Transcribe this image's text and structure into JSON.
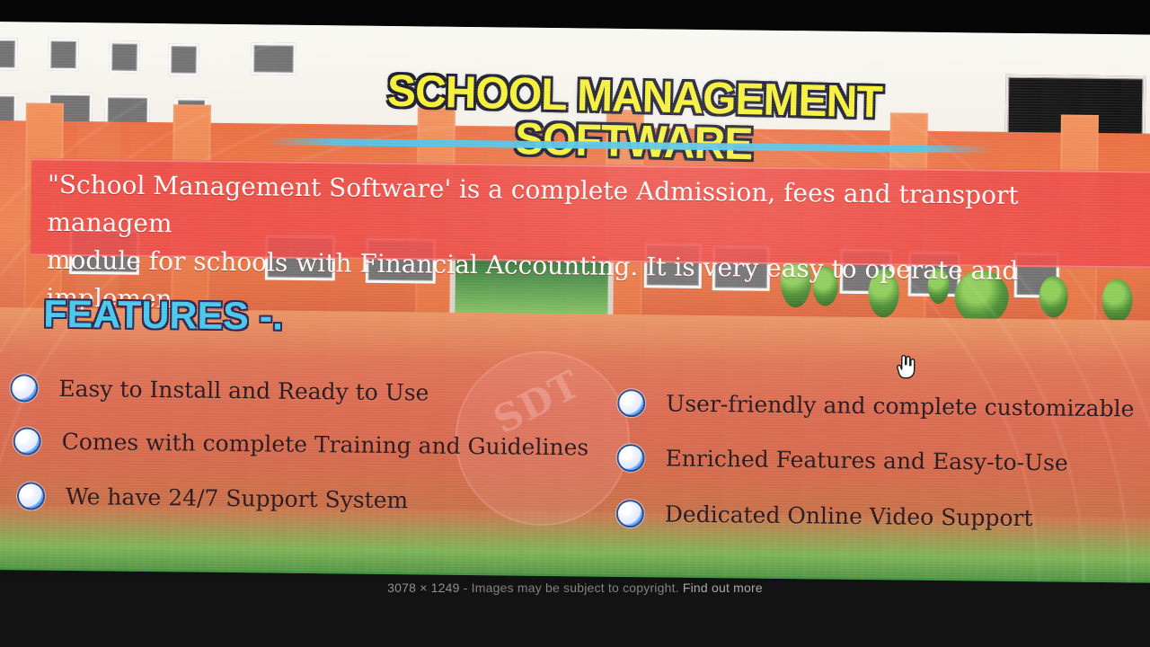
{
  "banner": {
    "title": "SCHOOL MANAGEMENT SOFTWARE",
    "intro_line_1": "\"School Management Software' is a complete Admission, fees and transport managem",
    "intro_line_2": "module for schools with Financial Accounting. It is very easy to operate and implemen",
    "features_heading": "FEATURES -.",
    "watermark": "SDT"
  },
  "features": {
    "left": [
      "Easy to Install and Ready to Use",
      "Comes with complete Training and Guidelines",
      "We have 24/7 Support System"
    ],
    "right": [
      "User-friendly and complete customizable",
      "Enriched Features and Easy-to-Use",
      "Dedicated Online Video Support"
    ]
  },
  "footer": {
    "dimensions": "3078 × 1249",
    "separator": " - ",
    "copyright": "Images may be subject to copyright.",
    "link": "Find out more"
  },
  "icons": {
    "bullet": "radio-circle-icon",
    "cursor": "hand-pointer-icon"
  },
  "colors": {
    "title_fill": "#f4ef2e",
    "title_outline": "#16162b",
    "heading_fill": "#46c7ea",
    "intro_band": "#ec4a46",
    "bullet_blue": "#2d88f0"
  }
}
